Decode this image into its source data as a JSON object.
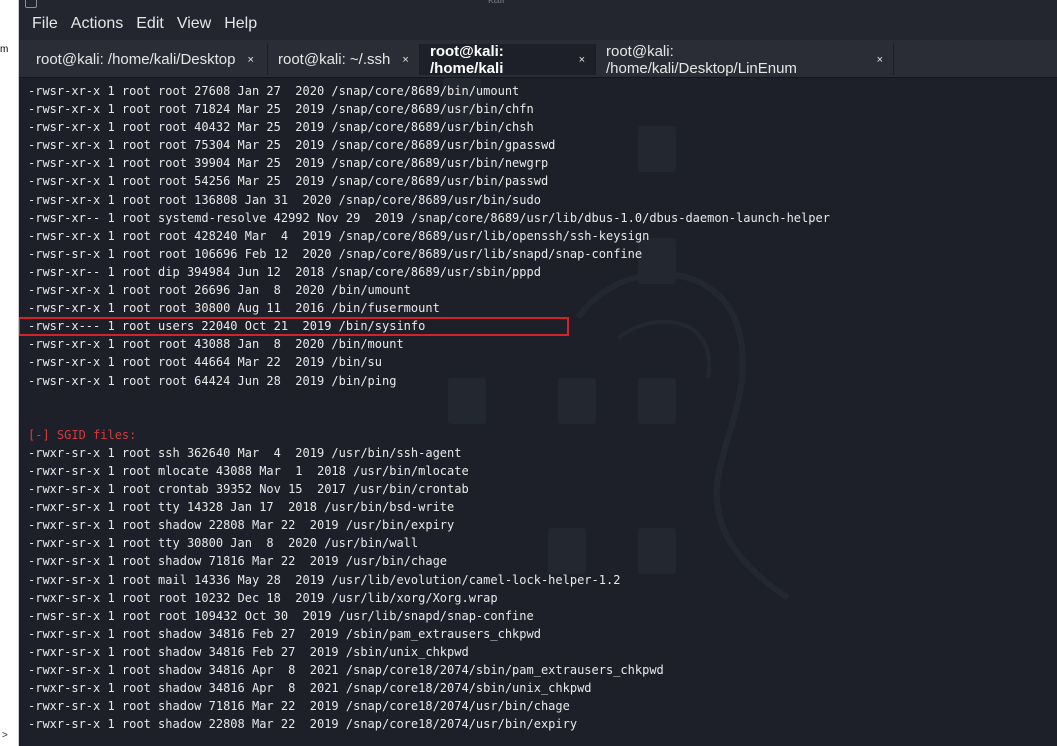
{
  "window": {
    "title_fragment": "kali",
    "left_strip_fragment": "m",
    "left_strip_chevron": ">"
  },
  "menu": [
    "File",
    "Actions",
    "Edit",
    "View",
    "Help"
  ],
  "tabs": [
    {
      "label": "root@kali: /home/kali/Desktop",
      "close": "×",
      "active": false
    },
    {
      "label": "root@kali: ~/.ssh",
      "close": "×",
      "active": false
    },
    {
      "label": "root@kali: /home/kali",
      "close": "×",
      "active": true
    },
    {
      "label": "root@kali: /home/kali/Desktop/LinEnum",
      "close": "×",
      "active": false
    }
  ],
  "terminal": {
    "lines": [
      {
        "text": "-rwsr-xr-x 1 root root 27608 Jan 27  2020 /snap/core/8689/bin/umount",
        "kind": "normal"
      },
      {
        "text": "-rwsr-xr-x 1 root root 71824 Mar 25  2019 /snap/core/8689/usr/bin/chfn",
        "kind": "normal"
      },
      {
        "text": "-rwsr-xr-x 1 root root 40432 Mar 25  2019 /snap/core/8689/usr/bin/chsh",
        "kind": "normal"
      },
      {
        "text": "-rwsr-xr-x 1 root root 75304 Mar 25  2019 /snap/core/8689/usr/bin/gpasswd",
        "kind": "normal"
      },
      {
        "text": "-rwsr-xr-x 1 root root 39904 Mar 25  2019 /snap/core/8689/usr/bin/newgrp",
        "kind": "normal"
      },
      {
        "text": "-rwsr-xr-x 1 root root 54256 Mar 25  2019 /snap/core/8689/usr/bin/passwd",
        "kind": "normal"
      },
      {
        "text": "-rwsr-xr-x 1 root root 136808 Jan 31  2020 /snap/core/8689/usr/bin/sudo",
        "kind": "normal"
      },
      {
        "text": "-rwsr-xr-- 1 root systemd-resolve 42992 Nov 29  2019 /snap/core/8689/usr/lib/dbus-1.0/dbus-daemon-launch-helper",
        "kind": "normal"
      },
      {
        "text": "-rwsr-xr-x 1 root root 428240 Mar  4  2019 /snap/core/8689/usr/lib/openssh/ssh-keysign",
        "kind": "normal"
      },
      {
        "text": "-rwsr-sr-x 1 root root 106696 Feb 12  2020 /snap/core/8689/usr/lib/snapd/snap-confine",
        "kind": "normal"
      },
      {
        "text": "-rwsr-xr-- 1 root dip 394984 Jun 12  2018 /snap/core/8689/usr/sbin/pppd",
        "kind": "normal"
      },
      {
        "text": "-rwsr-xr-x 1 root root 26696 Jan  8  2020 /bin/umount",
        "kind": "normal"
      },
      {
        "text": "-rwsr-xr-x 1 root root 30800 Aug 11  2016 /bin/fusermount",
        "kind": "normal"
      },
      {
        "text": "-rwsr-x--- 1 root users 22040 Oct 21  2019 /bin/sysinfo",
        "kind": "highlight"
      },
      {
        "text": "-rwsr-xr-x 1 root root 43088 Jan  8  2020 /bin/mount",
        "kind": "normal"
      },
      {
        "text": "-rwsr-xr-x 1 root root 44664 Mar 22  2019 /bin/su",
        "kind": "normal"
      },
      {
        "text": "-rwsr-xr-x 1 root root 64424 Jun 28  2019 /bin/ping",
        "kind": "normal"
      },
      {
        "text": "",
        "kind": "blank"
      },
      {
        "text": "",
        "kind": "blank"
      },
      {
        "text": "[-] SGID files:",
        "kind": "section"
      },
      {
        "text": "-rwxr-sr-x 1 root ssh 362640 Mar  4  2019 /usr/bin/ssh-agent",
        "kind": "normal"
      },
      {
        "text": "-rwxr-sr-x 1 root mlocate 43088 Mar  1  2018 /usr/bin/mlocate",
        "kind": "normal"
      },
      {
        "text": "-rwxr-sr-x 1 root crontab 39352 Nov 15  2017 /usr/bin/crontab",
        "kind": "normal"
      },
      {
        "text": "-rwxr-sr-x 1 root tty 14328 Jan 17  2018 /usr/bin/bsd-write",
        "kind": "normal"
      },
      {
        "text": "-rwxr-sr-x 1 root shadow 22808 Mar 22  2019 /usr/bin/expiry",
        "kind": "normal"
      },
      {
        "text": "-rwxr-sr-x 1 root tty 30800 Jan  8  2020 /usr/bin/wall",
        "kind": "normal"
      },
      {
        "text": "-rwxr-sr-x 1 root shadow 71816 Mar 22  2019 /usr/bin/chage",
        "kind": "normal"
      },
      {
        "text": "-rwxr-sr-x 1 root mail 14336 May 28  2019 /usr/lib/evolution/camel-lock-helper-1.2",
        "kind": "normal"
      },
      {
        "text": "-rwxr-sr-x 1 root root 10232 Dec 18  2019 /usr/lib/xorg/Xorg.wrap",
        "kind": "normal"
      },
      {
        "text": "-rwsr-sr-x 1 root root 109432 Oct 30  2019 /usr/lib/snapd/snap-confine",
        "kind": "normal"
      },
      {
        "text": "-rwxr-sr-x 1 root shadow 34816 Feb 27  2019 /sbin/pam_extrausers_chkpwd",
        "kind": "normal"
      },
      {
        "text": "-rwxr-sr-x 1 root shadow 34816 Feb 27  2019 /sbin/unix_chkpwd",
        "kind": "normal"
      },
      {
        "text": "-rwxr-sr-x 1 root shadow 34816 Apr  8  2021 /snap/core18/2074/sbin/pam_extrausers_chkpwd",
        "kind": "normal"
      },
      {
        "text": "-rwxr-sr-x 1 root shadow 34816 Apr  8  2021 /snap/core18/2074/sbin/unix_chkpwd",
        "kind": "normal"
      },
      {
        "text": "-rwxr-sr-x 1 root shadow 71816 Mar 22  2019 /snap/core18/2074/usr/bin/chage",
        "kind": "normal"
      },
      {
        "text": "-rwxr-sr-x 1 root shadow 22808 Mar 22  2019 /snap/core18/2074/usr/bin/expiry",
        "kind": "normal"
      }
    ]
  },
  "colors": {
    "terminal_bg": "#1d2028",
    "text": "#e9e9e9",
    "section": "#d33c3c",
    "highlight_border": "#d3232a"
  }
}
